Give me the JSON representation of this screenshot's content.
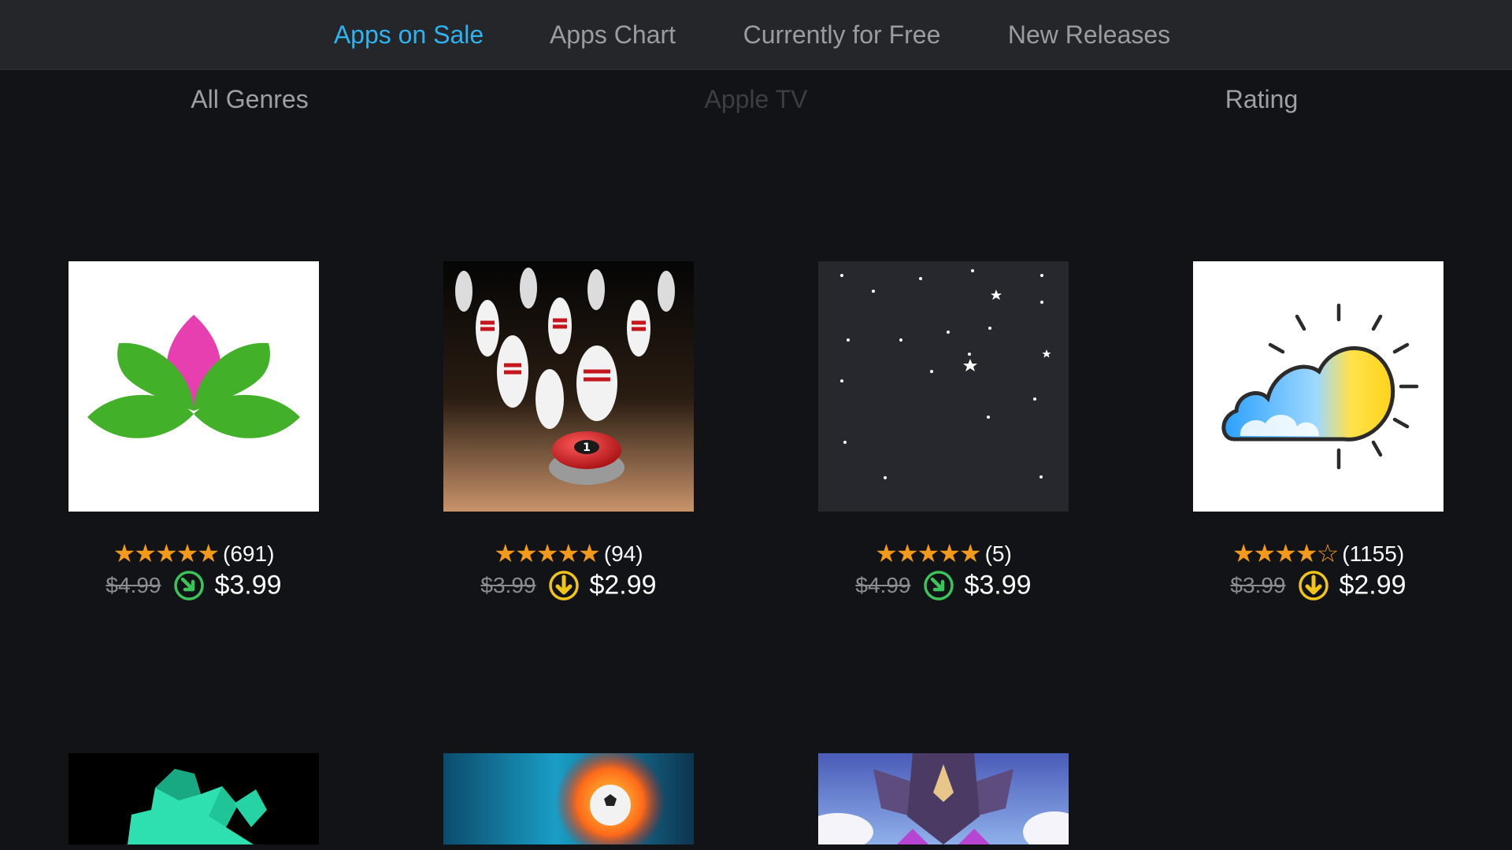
{
  "tabs": [
    {
      "label": "Apps on Sale"
    },
    {
      "label": "Apps Chart"
    },
    {
      "label": "Currently for Free"
    },
    {
      "label": "New Releases"
    }
  ],
  "filters": {
    "genre": "All Genres",
    "platform": "Apple TV",
    "sort": "Rating"
  },
  "apps": [
    {
      "icon": "lotus-icon",
      "stars": "★★★★★",
      "rating_count": "(691)",
      "old_price": "$4.99",
      "badge": "price-drop-icon",
      "new_price": "$3.99"
    },
    {
      "icon": "bowling-icon",
      "stars": "★★★★★",
      "rating_count": "(94)",
      "old_price": "$3.99",
      "badge": "price-down-arrow-icon",
      "new_price": "$2.99"
    },
    {
      "icon": "moon-icon",
      "stars": "★★★★★",
      "rating_count": "(5)",
      "old_price": "$4.99",
      "badge": "price-drop-icon",
      "new_price": "$3.99"
    },
    {
      "icon": "weather-icon",
      "stars": "★★★★☆",
      "rating_count": "(1155)",
      "old_price": "$3.99",
      "badge": "price-down-arrow-icon",
      "new_price": "$2.99"
    }
  ],
  "colors": {
    "accent": "#2fb3f0",
    "star": "#f39a1b",
    "badge_green": "#3cc35a",
    "badge_yellow": "#f0c419"
  }
}
